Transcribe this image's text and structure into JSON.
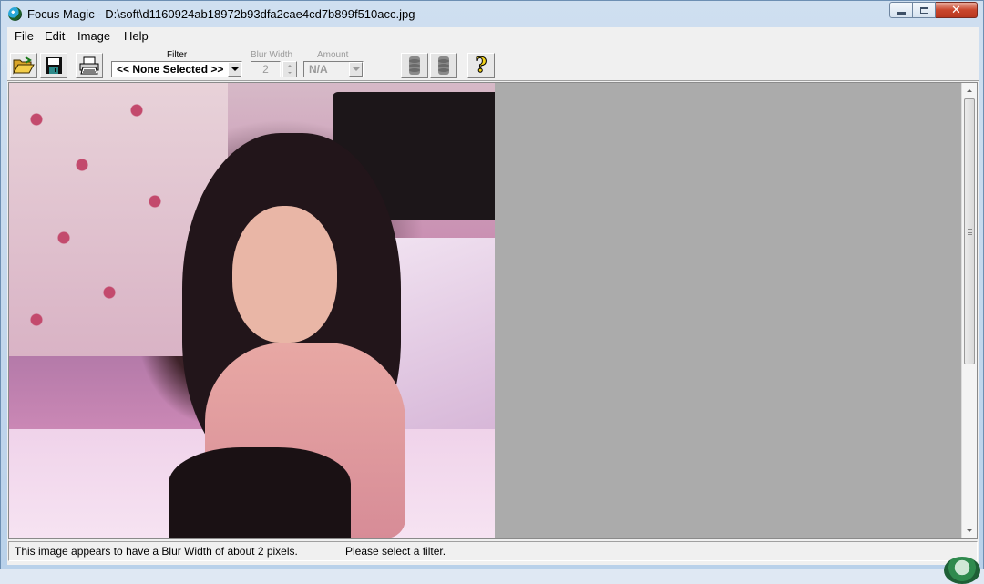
{
  "window": {
    "title": "Focus Magic - D:\\soft\\d1160924ab18972b93dfa2cae4cd7b899f510acc.jpg",
    "close_glyph": "✕"
  },
  "menu": [
    "File",
    "Edit",
    "Image",
    "Help"
  ],
  "toolbar": {
    "open_icon": "open-folder-icon",
    "save_icon": "floppy-disk-icon",
    "print_icon": "printer-icon",
    "filter_label": "Filter",
    "filter_value": "<< None Selected >>",
    "blur_width_label": "Blur Width",
    "blur_width_value": "2",
    "amount_label": "Amount",
    "amount_value": "N/A",
    "help_glyph": "?"
  },
  "status": {
    "message": "This image appears to have a Blur Width of about 2 pixels.",
    "hint": "Please select a filter."
  }
}
